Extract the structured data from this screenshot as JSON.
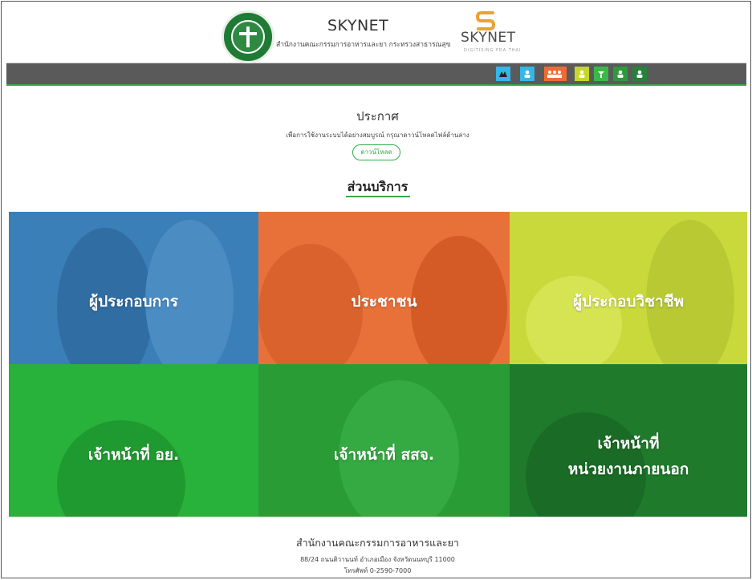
{
  "header": {
    "title": "SKYNET",
    "subtitle": "สำนักงานคณะกรรมการอาหารและยา กระทรวงสาธารณสุข",
    "fda_logo_text": "SKYNET",
    "fda_tagline": "DIGITISING FDA THAI",
    "colors": {
      "green": "#3aa64a",
      "orange": "#f0a030"
    }
  },
  "nav_icons": [
    {
      "name": "system-icon",
      "color": "#35b7e8"
    },
    {
      "name": "user-icon",
      "color": "#35b7e8"
    },
    {
      "name": "group-icon",
      "color": "#f06a35"
    },
    {
      "name": "professional-icon",
      "color": "#c8d62a"
    },
    {
      "name": "staff-icon",
      "color": "#3cb84a"
    },
    {
      "name": "officer-icon",
      "color": "#2d9a3d"
    },
    {
      "name": "external-icon",
      "color": "#25823a"
    }
  ],
  "announcement": {
    "title": "ประกาศ",
    "text": "เพื่อการใช้งานระบบได้อย่างสมบูรณ์ กรุณาดาวน์โหลดไฟล์ด้านล่าง",
    "download_label": "ดาวน์โหลด"
  },
  "services": {
    "title": "ส่วนบริการ",
    "tiles": [
      {
        "label": "ผู้ประกอบการ",
        "color": "#3b7fb8"
      },
      {
        "label": "ประชาชน",
        "color": "#e8713a"
      },
      {
        "label": "ผู้ประกอบวิชาชีพ",
        "color": "#c9d93c"
      },
      {
        "label": "เจ้าหน้าที่ อย.",
        "color": "#28b23b"
      },
      {
        "label": "เจ้าหน้าที่ สสจ.",
        "color": "#2a9c35"
      },
      {
        "label_line1": "เจ้าหน้าที่",
        "label_line2": "หน่วยงานภายนอก",
        "color": "#1f7a2c"
      }
    ]
  },
  "footer": {
    "org": "สำนักงานคณะกรรมการอาหารและยา",
    "address": "88/24 ถนนติวานนท์ อำเภอเมือง จังหวัดนนทบุรี 11000",
    "tel": "โทรศัพท์ 0-2590-7000"
  }
}
